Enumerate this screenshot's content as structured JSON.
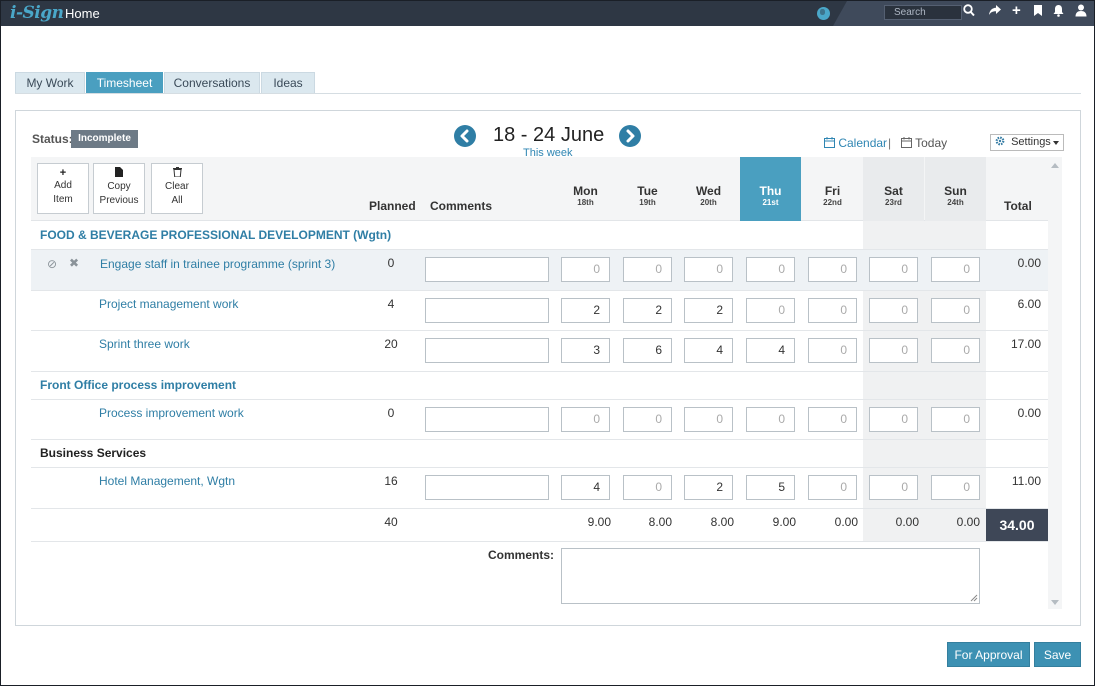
{
  "topbar": {
    "logo": "i-Sign",
    "title": "Home",
    "search_placeholder": "Search",
    "icons": [
      "globe-icon",
      "search-icon",
      "share-icon",
      "plus-icon",
      "bookmark-icon",
      "bell-icon",
      "user-icon"
    ]
  },
  "tabs": [
    {
      "label": "My Work",
      "active": false
    },
    {
      "label": "Timesheet",
      "active": true
    },
    {
      "label": "Conversations",
      "active": false
    },
    {
      "label": "Ideas",
      "active": false
    }
  ],
  "status": {
    "label": "Status:",
    "value": "Incomplete"
  },
  "week": {
    "range": "18 - 24 June",
    "subtitle": "This week"
  },
  "links": {
    "calendar": "Calendar",
    "separator": "|",
    "today": "Today",
    "settings": "Settings"
  },
  "actions": [
    {
      "icon": "+",
      "line1": "Add",
      "line2": "Item"
    },
    {
      "icon": "▮",
      "line1": "Copy",
      "line2": "Previous"
    },
    {
      "icon": "🗑",
      "line1": "Clear",
      "line2": "All"
    }
  ],
  "columns": {
    "planned": "Planned",
    "comments": "Comments",
    "total": "Total"
  },
  "days": [
    {
      "name": "Mon",
      "date": "18th"
    },
    {
      "name": "Tue",
      "date": "19th"
    },
    {
      "name": "Wed",
      "date": "20th"
    },
    {
      "name": "Thu",
      "date": "21st",
      "today": true
    },
    {
      "name": "Fri",
      "date": "22nd"
    },
    {
      "name": "Sat",
      "date": "23rd"
    },
    {
      "name": "Sun",
      "date": "24th"
    }
  ],
  "groups": [
    {
      "title": "FOOD & BEVERAGE PROFESSIONAL DEVELOPMENT (Wgtn)",
      "color": "#2f7ea5"
    },
    {
      "title": "Front Office process improvement",
      "color": "#2f7ea5"
    },
    {
      "title": "Business Services",
      "color": "#222222"
    }
  ],
  "tasks": [
    {
      "name": "Engage staff in trainee programme (sprint 3)",
      "planned": "0",
      "hours": [
        "0",
        "0",
        "0",
        "0",
        "0",
        "0",
        "0"
      ],
      "total": "0.00"
    },
    {
      "name": "Project management work",
      "planned": "4",
      "hours": [
        "2",
        "2",
        "2",
        "0",
        "0",
        "0",
        "0"
      ],
      "total": "6.00"
    },
    {
      "name": "Sprint three work",
      "planned": "20",
      "hours": [
        "3",
        "6",
        "4",
        "4",
        "0",
        "0",
        "0"
      ],
      "total": "17.00"
    },
    {
      "name": "Process improvement work",
      "planned": "0",
      "hours": [
        "0",
        "0",
        "0",
        "0",
        "0",
        "0",
        "0"
      ],
      "total": "0.00"
    },
    {
      "name": "Hotel Management, Wgtn",
      "planned": "16",
      "hours": [
        "4",
        "0",
        "2",
        "5",
        "0",
        "0",
        "0"
      ],
      "total": "11.00"
    }
  ],
  "footer": {
    "planned_total": "40",
    "day_totals": [
      "9.00",
      "8.00",
      "8.00",
      "9.00",
      "0.00",
      "0.00",
      "0.00"
    ],
    "grand_total": "34.00",
    "comments_label": "Comments:"
  },
  "buttons": {
    "approval": "For Approval",
    "save": "Save"
  }
}
